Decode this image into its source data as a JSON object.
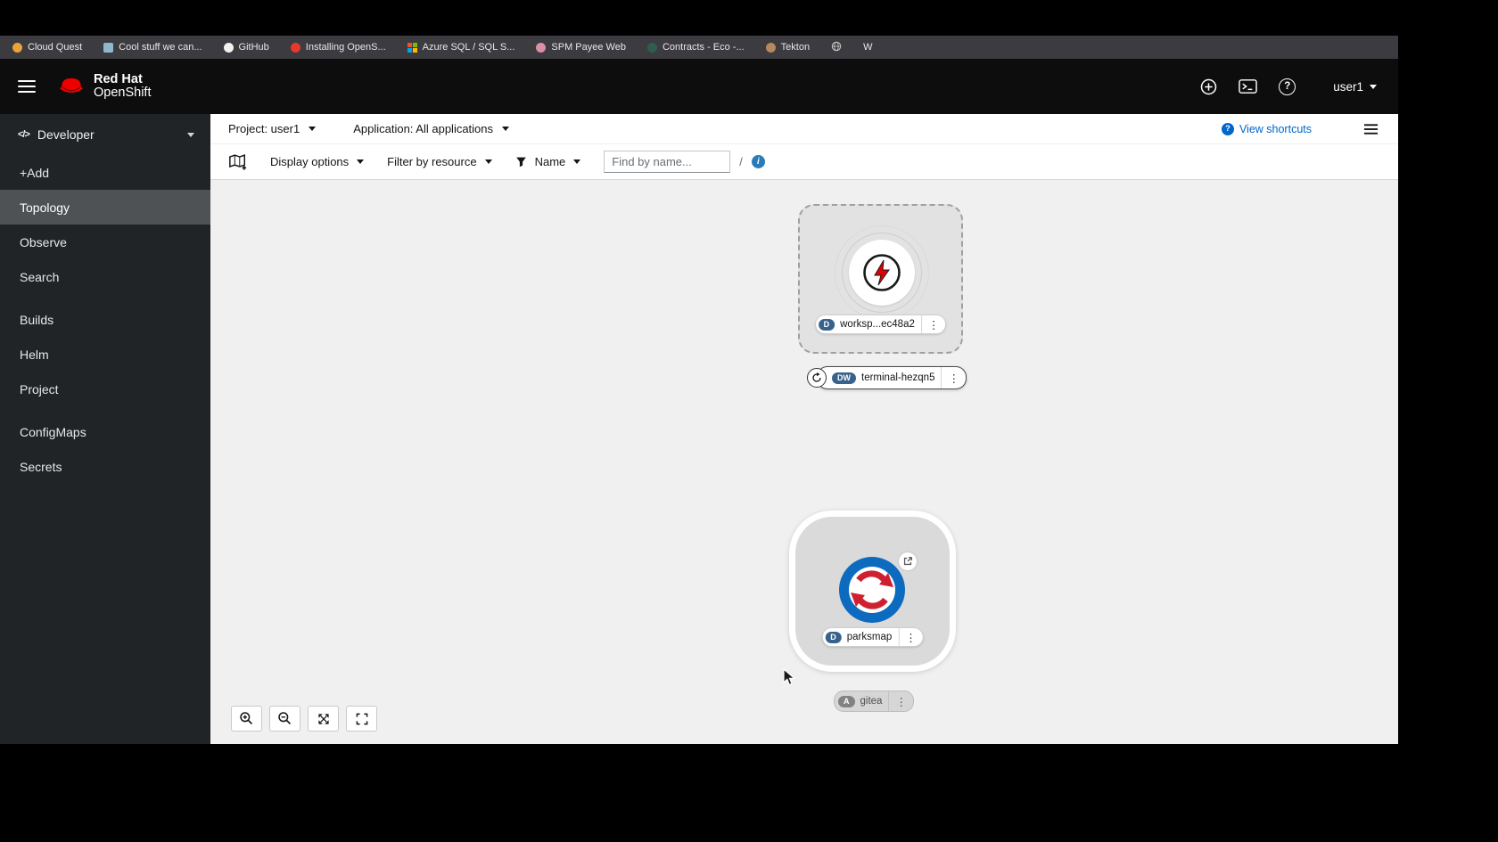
{
  "ui": {
    "kebab": "⋮",
    "help_glyph": "?",
    "info_glyph": "i",
    "code_icon_glyph": "</>"
  },
  "bookmarks": {
    "items": [
      {
        "label": "Cloud Quest",
        "icon": "yellow-dot"
      },
      {
        "label": "Cool stuff we can...",
        "icon": "blue-window"
      },
      {
        "label": "GitHub",
        "icon": "github"
      },
      {
        "label": "Installing OpenS...",
        "icon": "openshift-dot"
      },
      {
        "label": "Azure SQL / SQL S...",
        "icon": "ms-grid"
      },
      {
        "label": "SPM Payee Web",
        "icon": "pink-dot"
      },
      {
        "label": "Contracts - Eco -...",
        "icon": "green-dot"
      },
      {
        "label": "Tekton",
        "icon": "tan-dot"
      },
      {
        "label": "",
        "icon": "globe"
      },
      {
        "label": "W",
        "icon": "none"
      }
    ]
  },
  "masthead": {
    "brand_top": "Red Hat",
    "brand_bottom": "OpenShift",
    "username": "user1"
  },
  "sidebar": {
    "perspective": "Developer",
    "items": [
      "+Add",
      "Topology",
      "Observe",
      "Search",
      "Builds",
      "Helm",
      "Project",
      "ConfigMaps",
      "Secrets"
    ],
    "selected_item": "Topology"
  },
  "context_bar": {
    "project": "Project: user1",
    "application": "Application: All applications",
    "view_shortcuts": "View shortcuts"
  },
  "filter_bar": {
    "display_options": "Display options",
    "filter_by_resource": "Filter by resource",
    "name": "Name",
    "search_placeholder": "Find by name...",
    "shortcut_hint": "/"
  },
  "topology": {
    "workspace": {
      "badge": "D",
      "name": "worksp...ec48a2"
    },
    "terminal": {
      "badge": "DW",
      "name": "terminal-hezqn5"
    },
    "parksmap": {
      "badge": "D",
      "name": "parksmap"
    },
    "gitea": {
      "badge": "A",
      "name": "gitea"
    }
  },
  "colors": {
    "brand_red": "#ee0000",
    "accent_blue": "#0066cc",
    "badge_blue": "#38628c",
    "badge_gray": "#808285",
    "sidebar_bg": "#212427",
    "selected_nav": "#4f5255",
    "canvas_bg": "#f0f0f0"
  }
}
